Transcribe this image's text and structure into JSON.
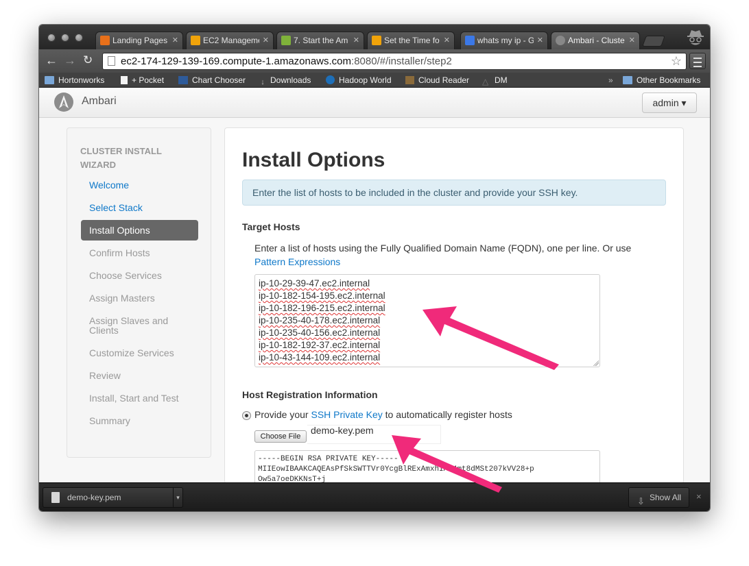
{
  "browser": {
    "tabs": [
      {
        "label": "Landing Pages",
        "icon": "chart-favicon",
        "color": "#e8701a"
      },
      {
        "label": "EC2 Manageme",
        "icon": "aws-cube-favicon",
        "color": "#f0a30a"
      },
      {
        "label": "7. Start the Am",
        "icon": "hadoop-elephant-favicon",
        "color": "#7fb23a"
      },
      {
        "label": "Set the Time fo",
        "icon": "aws-cube-favicon",
        "color": "#f0a30a"
      },
      {
        "label": "whats my ip - G",
        "icon": "google-favicon",
        "color": "#3b78e7"
      },
      {
        "label": "Ambari - Cluste",
        "icon": "ambari-favicon",
        "color": "#888888"
      }
    ],
    "url_host": "ec2-174-129-139-169.compute-1.amazonaws.com",
    "url_rest": ":8080/#/installer/step2",
    "bookmarks": [
      {
        "label": "Hortonworks",
        "icon": "folder-icon"
      },
      {
        "label": "+ Pocket",
        "icon": "document-icon"
      },
      {
        "label": "Chart Chooser",
        "icon": "chart-chooser-icon"
      },
      {
        "label": "Downloads",
        "icon": "download-arrow-icon"
      },
      {
        "label": "Hadoop World",
        "icon": "hadoop-world-icon"
      },
      {
        "label": "Cloud Reader",
        "icon": "kindle-icon"
      },
      {
        "label": "DM",
        "icon": "triangle-icon"
      }
    ],
    "overflow_chevron": "»",
    "other_bookmarks": "Other Bookmarks"
  },
  "app": {
    "brand": "Ambari",
    "user_menu": "admin ▾"
  },
  "sidebar": {
    "title": "CLUSTER INSTALL WIZARD",
    "items": [
      {
        "label": "Welcome",
        "state": "link"
      },
      {
        "label": "Select Stack",
        "state": "link"
      },
      {
        "label": "Install Options",
        "state": "active"
      },
      {
        "label": "Confirm Hosts",
        "state": "muted"
      },
      {
        "label": "Choose Services",
        "state": "muted"
      },
      {
        "label": "Assign Masters",
        "state": "muted"
      },
      {
        "label": "Assign Slaves and Clients",
        "state": "muted"
      },
      {
        "label": "Customize Services",
        "state": "muted"
      },
      {
        "label": "Review",
        "state": "muted"
      },
      {
        "label": "Install, Start and Test",
        "state": "muted"
      },
      {
        "label": "Summary",
        "state": "muted"
      }
    ]
  },
  "main": {
    "title": "Install Options",
    "info": "Enter the list of hosts to be included in the cluster and provide your SSH key.",
    "target_hosts": {
      "heading": "Target Hosts",
      "instructions": "Enter a list of hosts using the Fully Qualified Domain Name (FQDN), one per line. Or use",
      "pattern_link": "Pattern Expressions",
      "hosts": [
        "ip-10-29-39-47.ec2.internal",
        "ip-10-182-154-195.ec2.internal",
        "ip-10-182-196-215.ec2.internal",
        "ip-10-235-40-178.ec2.internal",
        "ip-10-235-40-156.ec2.internal",
        "ip-10-182-192-37.ec2.internal",
        "ip-10-43-144-109.ec2.internal"
      ]
    },
    "registration": {
      "heading": "Host Registration Information",
      "radio_prefix": "Provide your",
      "ssh_link": "SSH Private Key",
      "radio_suffix": "to automatically register hosts",
      "choose_file": "Choose File",
      "file_name": "demo-key.pem",
      "key_line1": "-----BEGIN RSA PRIVATE KEY-----",
      "key_line2": "MIIEowIBAAKCAQEAsPfSkSWTTVr0YcgBlRExAmxhIAu4mt8dMSt207kVV28+p",
      "key_line3": "Ow5a7oeDKKNsT+j"
    }
  },
  "download_shelf": {
    "file": "demo-key.pem",
    "show_all": "Show All",
    "close": "×"
  },
  "colors": {
    "link": "#0e78c9",
    "active_nav": "#676767",
    "info_bg": "#dfeef5",
    "annotation_arrow": "#f02a7a"
  }
}
